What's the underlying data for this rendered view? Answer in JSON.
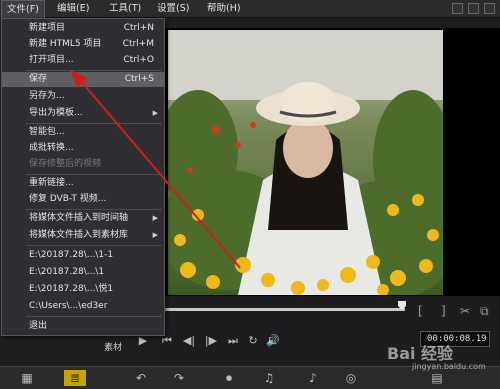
{
  "menubar": {
    "items": [
      {
        "label": "文件(F)"
      },
      {
        "label": "编辑(E)"
      },
      {
        "label": "工具(T)"
      },
      {
        "label": "设置(S)"
      },
      {
        "label": "帮助(H)"
      }
    ]
  },
  "file_menu": {
    "items": [
      {
        "label": "新建项目",
        "shortcut": "Ctrl+N"
      },
      {
        "label": "新建 HTML5 项目",
        "shortcut": "Ctrl+M"
      },
      {
        "label": "打开项目...",
        "shortcut": "Ctrl+O"
      },
      {
        "label": "保存",
        "shortcut": "Ctrl+S"
      },
      {
        "label": "另存为..."
      },
      {
        "label": "导出为模板..."
      },
      {
        "label": "智能包..."
      },
      {
        "label": "成批转换..."
      },
      {
        "label": "保存修整后的视频"
      },
      {
        "label": "重新链接..."
      },
      {
        "label": "修复 DVB-T 视频..."
      },
      {
        "label": "将媒体文件插入到时间轴"
      },
      {
        "label": "将媒体文件插入到素材库"
      },
      {
        "label": "E:\\20187.28\\...\\1-1"
      },
      {
        "label": "E:\\20187.28\\...\\1"
      },
      {
        "label": "E:\\20187.28\\...\\悦1"
      },
      {
        "label": "C:\\Users\\...\\ed3er"
      },
      {
        "label": "退出"
      }
    ]
  },
  "player": {
    "timecode": "00:00:08.19",
    "project_label": "素材"
  },
  "watermark": {
    "text": "Bai 经验",
    "url": "jingyan.baidu.com"
  },
  "colors": {
    "annotation_arrow": "#cc1f1f",
    "menu_bg": "#2f2f33",
    "highlight": "#5e5e63"
  }
}
